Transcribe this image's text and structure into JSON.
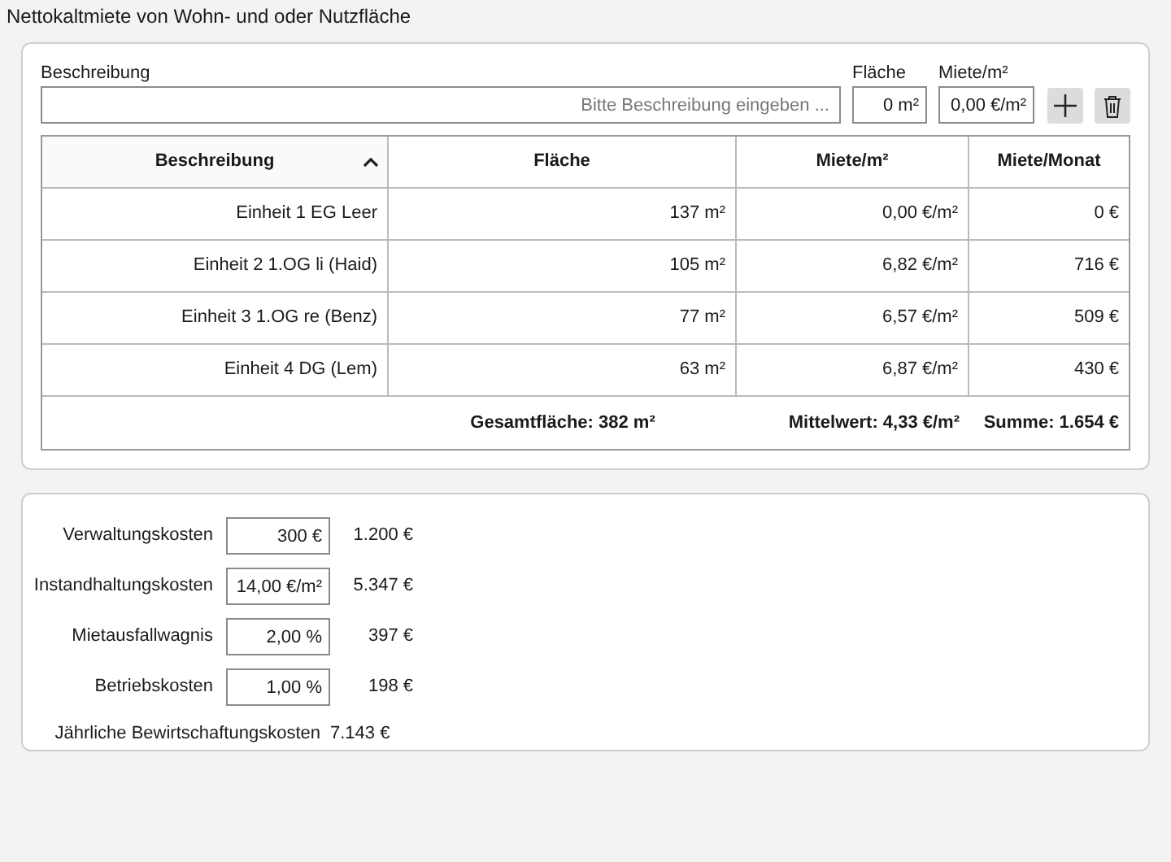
{
  "title": "Nettokaltmiete von Wohn- und oder Nutzfläche",
  "entry": {
    "description_label": "Beschreibung",
    "description_placeholder": "Bitte Beschreibung eingeben ...",
    "area_label": "Fläche",
    "area_value": "0 m²",
    "rent_label": "Miete/m²",
    "rent_value": "0,00 €/m²"
  },
  "table": {
    "columns": [
      {
        "label": "Beschreibung",
        "sorted": true
      },
      {
        "label": "Fläche",
        "sorted": false
      },
      {
        "label": "Miete/m²",
        "sorted": false
      },
      {
        "label": "Miete/Monat",
        "sorted": false
      }
    ],
    "rows": [
      [
        "Einheit 1 EG Leer",
        "137 m²",
        "0,00 €/m²",
        "0 €"
      ],
      [
        "Einheit 2 1.OG li (Haid)",
        "105 m²",
        "6,82 €/m²",
        "716 €"
      ],
      [
        "Einheit 3 1.OG re (Benz)",
        "77 m²",
        "6,57 €/m²",
        "509 €"
      ],
      [
        "Einheit 4 DG (Lem)",
        "63 m²",
        "6,87 €/m²",
        "430 €"
      ]
    ],
    "footer": [
      "Gesamtfläche: 382 m²",
      "Mittelwert: 4,33 €/m²",
      "Summe: 1.654 €"
    ]
  },
  "costs": [
    {
      "label": "Verwaltungskosten",
      "input": "300 €",
      "value": "1.200 €"
    },
    {
      "label": "Instandhaltungskosten",
      "input": "14,00 €/m²",
      "value": "5.347 €"
    },
    {
      "label": "Mietausfallwagnis",
      "input": "2,00 %",
      "value": "397 €"
    },
    {
      "label": "Betriebskosten",
      "input": "1,00 %",
      "value": "198 €"
    }
  ],
  "total": {
    "label": "Jährliche Bewirtschaftungskosten",
    "value": "7.143 €"
  }
}
